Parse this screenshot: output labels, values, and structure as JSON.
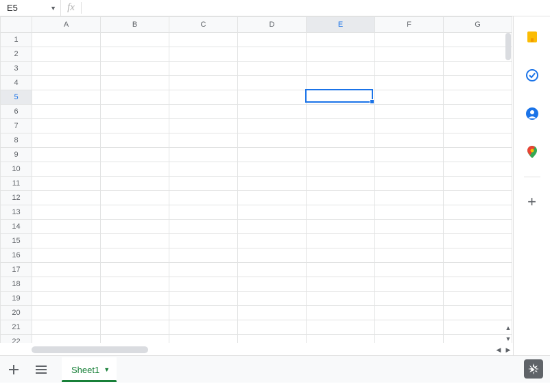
{
  "formula_bar": {
    "cell_ref": "E5",
    "fx_label": "fx",
    "formula_value": ""
  },
  "grid": {
    "columns": [
      "A",
      "B",
      "C",
      "D",
      "E",
      "F",
      "G"
    ],
    "rows": [
      "1",
      "2",
      "3",
      "4",
      "5",
      "6",
      "7",
      "8",
      "9",
      "10",
      "11",
      "12",
      "13",
      "14",
      "15",
      "16",
      "17",
      "18",
      "19",
      "20",
      "21",
      "22"
    ],
    "selected": {
      "col": "E",
      "row": "5",
      "col_index": 4,
      "row_index": 4
    }
  },
  "tabs": {
    "add_tooltip": "Add sheet",
    "all_sheets_tooltip": "All sheets",
    "sheets": [
      {
        "name": "Sheet1",
        "active": true
      }
    ]
  },
  "side_panel": {
    "items": [
      {
        "id": "keep",
        "color": "#fbbc04"
      },
      {
        "id": "tasks",
        "color": "#1a73e8"
      },
      {
        "id": "contacts",
        "color": "#1a73e8"
      },
      {
        "id": "maps",
        "color": "#34a853"
      }
    ],
    "add_label": "+"
  },
  "explore": {
    "label": "Explore"
  }
}
